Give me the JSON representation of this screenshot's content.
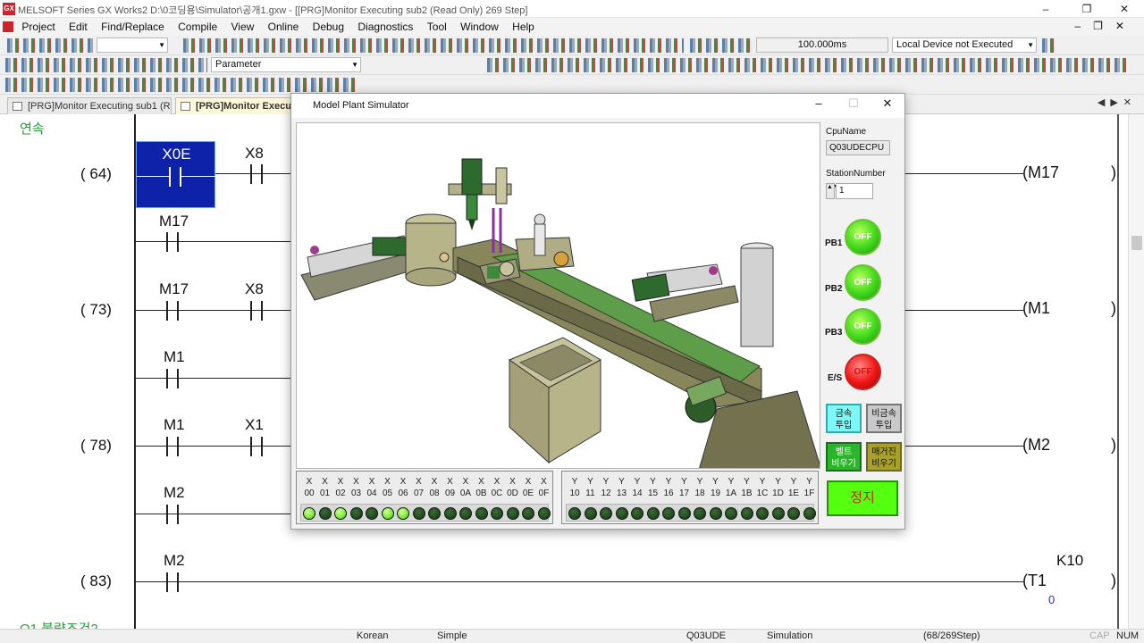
{
  "window": {
    "title": "MELSOFT Series GX Works2 D:\\0코딩용\\Simulator\\공개1.gxw - [[PRG]Monitor Executing sub2 (Read Only) 269 Step]"
  },
  "menu": {
    "items": [
      "Project",
      "Edit",
      "Find/Replace",
      "Compile",
      "View",
      "Online",
      "Debug",
      "Diagnostics",
      "Tool",
      "Window",
      "Help"
    ]
  },
  "toolbar": {
    "scan_time": "100.000ms",
    "local_device": "Local Device not Executed",
    "parameter_combo": "Parameter"
  },
  "tabs": [
    {
      "label": "[PRG]Monitor Executing sub1 (R..."
    },
    {
      "label": "[PRG]Monitor Executing sub2 (Read Only) 269 Step]"
    }
  ],
  "ladder": {
    "label_top": "연속",
    "label_bottom": "Q1 불량조건2",
    "rungs": [
      {
        "step": "(     64)",
        "contacts": [
          "X0E",
          "X8"
        ],
        "coil": "M17"
      },
      {
        "step": "",
        "contacts": [
          "M17"
        ],
        "coil": ""
      },
      {
        "step": "(     73)",
        "contacts": [
          "M17",
          "X8"
        ],
        "coil": "M1"
      },
      {
        "step": "",
        "contacts": [
          "M1"
        ],
        "coil": ""
      },
      {
        "step": "(     78)",
        "contacts": [
          "M1",
          "X1"
        ],
        "coil": "M2"
      },
      {
        "step": "",
        "contacts": [
          "M2"
        ],
        "coil": ""
      },
      {
        "step": "(     83)",
        "contacts": [
          "M2"
        ],
        "coil": "T1",
        "coil_param": "K10",
        "coil_value": "0"
      }
    ]
  },
  "simulator": {
    "title": "Model Plant Simulator",
    "cpu_name_label": "CpuName",
    "cpu_name": "Q03UDECPU",
    "station_label": "StationNumber",
    "station_value": "1",
    "pb1_label": "PB1",
    "pb1_state": "OFF",
    "pb2_label": "PB2",
    "pb2_state": "OFF",
    "pb3_label": "PB3",
    "pb3_state": "OFF",
    "es_label": "E/S",
    "es_state": "OFF",
    "metal_btn": "금속\n투입",
    "nonmetal_btn": "비금속\n투입",
    "belt_btn": "벨트\n비우기",
    "magazine_btn": "매거진\n비우기",
    "stop_btn": "정지",
    "x_inputs": [
      "00",
      "01",
      "02",
      "03",
      "04",
      "05",
      "06",
      "07",
      "08",
      "09",
      "0A",
      "0B",
      "0C",
      "0D",
      "0E",
      "0F"
    ],
    "x_states": [
      1,
      0,
      1,
      0,
      0,
      1,
      1,
      0,
      0,
      0,
      0,
      0,
      0,
      0,
      0,
      0
    ],
    "y_outputs": [
      "10",
      "11",
      "12",
      "13",
      "14",
      "15",
      "16",
      "17",
      "18",
      "19",
      "1A",
      "1B",
      "1C",
      "1D",
      "1E",
      "1F"
    ],
    "y_states": [
      0,
      0,
      0,
      0,
      0,
      0,
      0,
      0,
      0,
      0,
      0,
      0,
      0,
      0,
      0,
      0
    ],
    "x_prefix": "X",
    "y_prefix": "Y"
  },
  "status": {
    "language": "Korean",
    "mode": "Simple",
    "cpu": "Q03UDE",
    "connection": "Simulation",
    "steps": "(68/269Step)",
    "cap": "CAP",
    "num": "NUM"
  }
}
